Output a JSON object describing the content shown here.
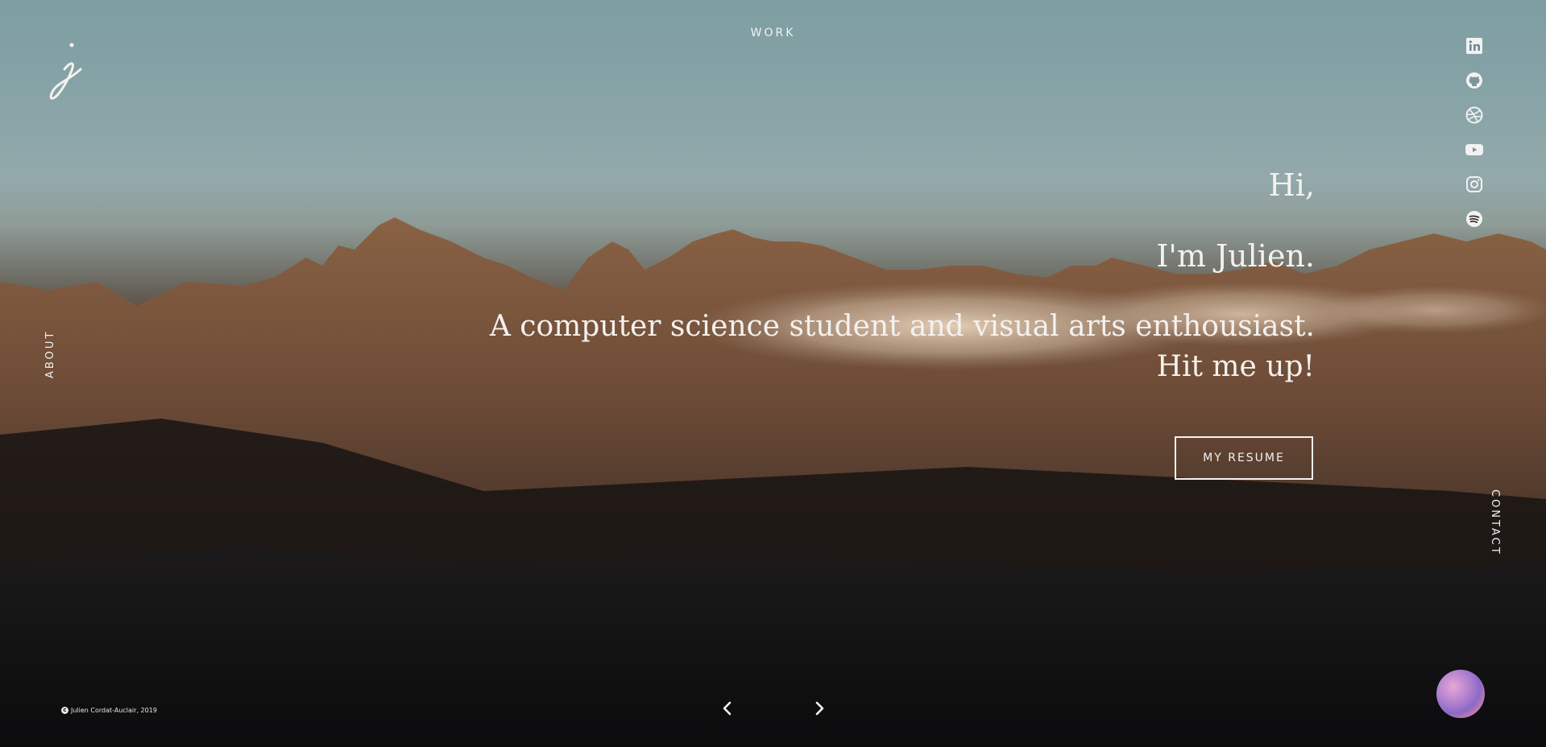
{
  "logo": {
    "glyph": "j"
  },
  "nav": {
    "work": "WORK",
    "about": "ABOUT",
    "contact": "CONTACT"
  },
  "socials": [
    {
      "icon": "linkedin-icon"
    },
    {
      "icon": "github-icon"
    },
    {
      "icon": "dribbble-icon"
    },
    {
      "icon": "youtube-icon"
    },
    {
      "icon": "instagram-icon"
    },
    {
      "icon": "spotify-icon"
    }
  ],
  "hero": {
    "greeting": "Hi,",
    "name_line": "I'm Julien.",
    "tagline_line1": "A computer science student and visual arts enthousiast.",
    "tagline_line2": "Hit me up!"
  },
  "resume_button": {
    "label": "MY RESUME"
  },
  "footer": {
    "copyright": "Julien Cordat-Auclair, 2019",
    "copy_symbol": "c"
  },
  "pager": {
    "prev_icon": "chevron-left-icon",
    "next_icon": "chevron-right-icon"
  },
  "colors": {
    "text": "#f2f2f2",
    "sky": "#86a3a6",
    "mountain": "#6b4a36",
    "ground": "#0d0c0e"
  }
}
